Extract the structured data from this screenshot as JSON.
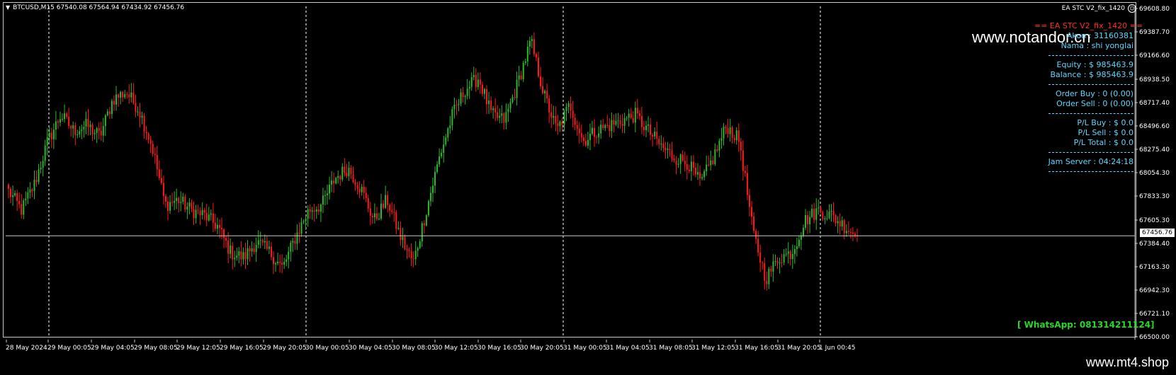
{
  "header": {
    "symbol_info": "BTCUSD,M15  67540.08 67564.94 67434.92 67456.76",
    "ea_name": "EA STC V2_fix_1420"
  },
  "panel": {
    "title": "== EA STC V2_fix_1420 ==",
    "akun": "Akun : 31160381",
    "nama": "Nama : shi yonglai",
    "equity": "Equity : $ 985463.9",
    "balance": "Balance : $ 985463.9",
    "order_buy": "Order Buy : 0 (0.00)",
    "order_sell": "Order Sell : 0 (0.00)",
    "pl_buy": "P/L Buy : $ 0.0",
    "pl_sell": "P/L Sell : $ 0.0",
    "pl_total": "P/L Total : $ 0.0",
    "jam_server": "Jam Server : 04:24:18"
  },
  "watermark": "www.notandor.cn",
  "whatsapp": "[ WhatsApp: 081314211124]",
  "brand": "www.mt4.shop",
  "current_price": "67456.76",
  "colors": {
    "bull": "#2db92d",
    "bear": "#ff1a1a",
    "grid": "#ffffff",
    "accent": "#5fd7ff"
  },
  "chart_data": {
    "type": "candlestick",
    "symbol": "BTCUSD",
    "timeframe": "M15",
    "ylim": [
      66500.0,
      69608.8
    ],
    "y_ticks": [
      "69608.80",
      "69387.70",
      "69166.60",
      "68938.50",
      "68717.40",
      "68496.60",
      "68275.40",
      "68054.30",
      "67833.30",
      "67605.30",
      "67384.40",
      "67163.30",
      "66942.30",
      "66721.10",
      "66500.00"
    ],
    "x_ticks": [
      "28 May 2024",
      "29 May 00:05",
      "29 May 04:05",
      "29 May 08:05",
      "29 May 12:05",
      "29 May 16:05",
      "29 May 20:05",
      "30 May 00:05",
      "30 May 04:05",
      "30 May 08:05",
      "30 May 12:05",
      "30 May 16:05",
      "30 May 20:05",
      "31 May 00:05",
      "31 May 04:05",
      "31 May 08:05",
      "31 May 12:05",
      "31 May 16:05",
      "31 May 20:05",
      "1 Jun 00:45"
    ],
    "close_path": [
      67880,
      67700,
      67950,
      68350,
      68600,
      68450,
      68500,
      68400,
      68750,
      68820,
      68650,
      68300,
      67750,
      67800,
      67700,
      67650,
      67550,
      67300,
      67250,
      67400,
      67300,
      67150,
      67450,
      67700,
      67750,
      68000,
      68100,
      67900,
      67600,
      67800,
      67450,
      67200,
      67700,
      68200,
      68600,
      68850,
      68950,
      68600,
      68550,
      68900,
      69300,
      68800,
      68450,
      68700,
      68350,
      68450,
      68500,
      68550,
      68600,
      68450,
      68300,
      68200,
      68150,
      67950,
      68200,
      68500,
      68350,
      67500,
      67050,
      67250,
      67300,
      67600,
      67700,
      67650,
      67550,
      67456.76
    ],
    "current_price": 67456.76
  }
}
